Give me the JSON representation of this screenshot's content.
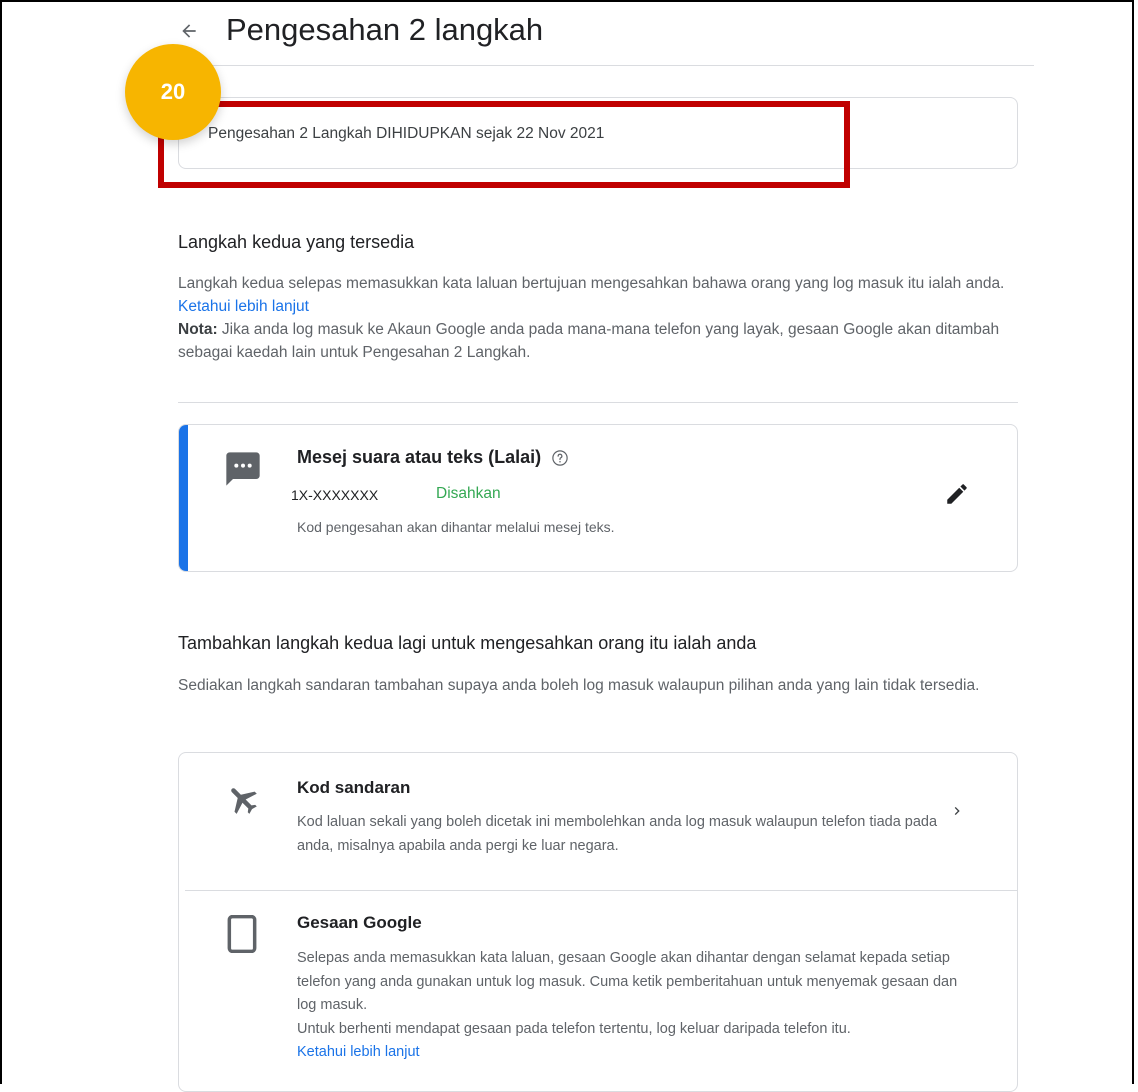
{
  "header": {
    "back_icon": "arrow-left-icon",
    "title": "Pengesahan 2 langkah"
  },
  "annotation": {
    "step_number": "20",
    "badge_color": "#f7b500",
    "highlight_color": "#c00000"
  },
  "status": {
    "text": "Pengesahan 2 Langkah DIHIDUPKAN sejak 22 Nov 2021"
  },
  "available": {
    "heading": "Langkah kedua yang tersedia",
    "desc_line1": "Langkah kedua selepas memasukkan kata laluan bertujuan mengesahkan bahawa orang yang log masuk itu ialah anda. ",
    "learn_more": "Ketahui lebih lanjut",
    "note_label": "Nota:",
    "note_text": " Jika anda log masuk ke Akaun Google anda pada mana-mana telefon yang layak, gesaan Google akan ditambah sebagai kaedah lain untuk Pengesahan 2 Langkah."
  },
  "method": {
    "icon": "sms-icon",
    "title": "Mesej suara atau teks (Lalai)",
    "help_icon": "help-icon",
    "phone": "1X-XXXXXXX",
    "status": "Disahkan",
    "description": "Kod pengesahan akan dihantar melalui mesej teks.",
    "edit_icon": "pencil-icon",
    "accent_color": "#1a73e8",
    "status_color": "#34a853"
  },
  "add_more": {
    "heading": "Tambahkan langkah kedua lagi untuk mengesahkan orang itu ialah anda",
    "description": "Sediakan langkah sandaran tambahan supaya anda boleh log masuk walaupun pilihan anda yang lain tidak tersedia."
  },
  "options": [
    {
      "icon": "airplane-icon",
      "title": "Kod sandaran",
      "description": "Kod laluan sekali yang boleh dicetak ini membolehkan anda log masuk walaupun telefon tiada pada anda, misalnya apabila anda pergi ke luar negara.",
      "chevron": "chevron-right-icon"
    },
    {
      "icon": "smartphone-icon",
      "title": "Gesaan Google",
      "description": "Selepas anda memasukkan kata laluan, gesaan Google akan dihantar dengan selamat kepada setiap telefon yang anda gunakan untuk log masuk. Cuma ketik pemberitahuan untuk menyemak gesaan dan log masuk.",
      "description2": "Untuk berhenti mendapat gesaan pada telefon tertentu, log keluar daripada telefon itu.",
      "learn_more": "Ketahui lebih lanjut"
    }
  ]
}
